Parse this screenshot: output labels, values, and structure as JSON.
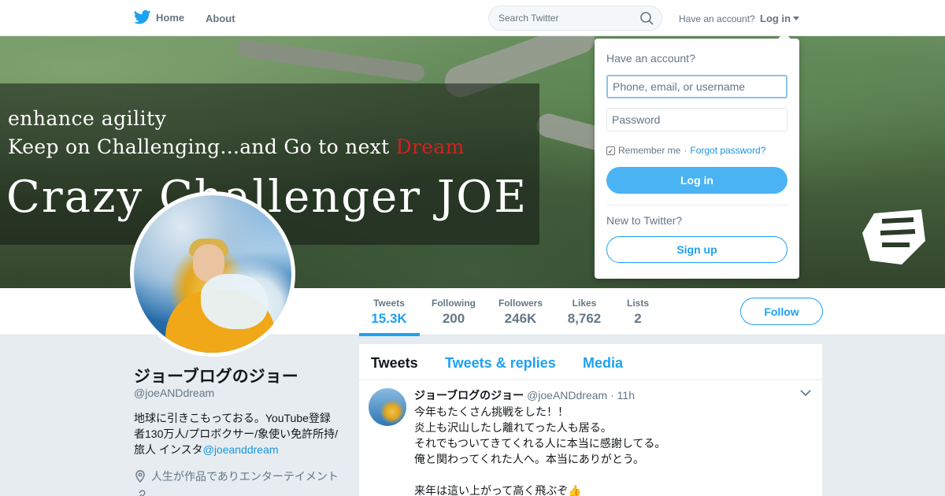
{
  "nav": {
    "home_label": "Home",
    "about_label": "About",
    "search_placeholder": "Search Twitter",
    "have_account": "Have an account?",
    "login_label": "Log in",
    "brand_color": "#1da1f2"
  },
  "banner": {
    "line1": "enhance agility",
    "line2_pre": "Keep on Challenging...and Go to next ",
    "line2_dream": "Dream",
    "line3": "Crazy Challenger JOE"
  },
  "stats": [
    {
      "label": "Tweets",
      "value": "15.3K"
    },
    {
      "label": "Following",
      "value": "200"
    },
    {
      "label": "Followers",
      "value": "246K"
    },
    {
      "label": "Likes",
      "value": "8,762"
    },
    {
      "label": "Lists",
      "value": "2"
    }
  ],
  "follow_label": "Follow",
  "profile": {
    "name": "ジョーブログのジョー",
    "handle": "@joeANDdream",
    "bio_text": "地球に引きこもっておる。YouTube登録者130万人/プロボクサー/象使い免許所持/旅人 インスタ",
    "bio_link": "@joeanddream",
    "location": "人生が作品でありエンターテイメント"
  },
  "timeline": {
    "tabs": [
      "Tweets",
      "Tweets & replies",
      "Media"
    ],
    "tweet": {
      "name": "ジョーブログのジョー",
      "handle": "@joeANDdream",
      "sep": "·",
      "time": "11h",
      "lines": [
        "今年もたくさん挑戦をした！！",
        "炎上も沢山したし離れてった人も居る。",
        "それでもついてきてくれる人に本当に感謝してる。",
        "俺と関わってくれた人へ。本当にありがとう。",
        "",
        "来年は這い上がって高く飛ぶぞ👍"
      ]
    }
  },
  "login_dropdown": {
    "title": "Have an account?",
    "username_placeholder": "Phone, email, or username",
    "password_placeholder": "Password",
    "remember_label": "Remember me",
    "sep": " · ",
    "forgot_label": "Forgot password?",
    "login_button": "Log in",
    "new_label": "New to Twitter?",
    "signup_button": "Sign up"
  }
}
